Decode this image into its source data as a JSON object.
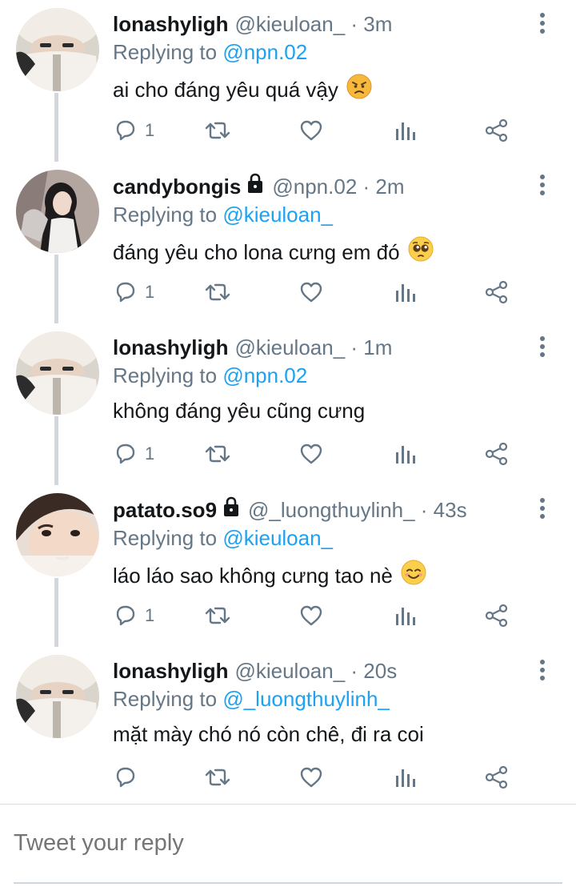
{
  "tweets": [
    {
      "name": "lonashyligh",
      "locked": false,
      "handle_time": "@kieuloan_ · 3m",
      "replying_prefix": "Replying to",
      "replying_to": "@npn.02",
      "text": "ai cho đáng yêu quá vậy",
      "emoji": "angry-face",
      "reply_count": "1",
      "avatar": "white-fluffy-hat-photo"
    },
    {
      "name": "candybongis",
      "locked": true,
      "handle_time": "@npn.02 · 2m",
      "replying_prefix": "Replying to",
      "replying_to": "@kieuloan_",
      "text": "đáng yêu cho lona cưng em đó",
      "emoji": "pleading-face",
      "reply_count": "1",
      "avatar": "girl-dark-hair-photo"
    },
    {
      "name": "lonashyligh",
      "locked": false,
      "handle_time": "@kieuloan_ · 1m",
      "replying_prefix": "Replying to",
      "replying_to": "@npn.02",
      "text": "không đáng yêu cũng cưng",
      "emoji": "",
      "reply_count": "1",
      "avatar": "white-fluffy-hat-photo"
    },
    {
      "name": "patato.so9",
      "locked": true,
      "handle_time": "@_luongthuylinh_ · 43s",
      "replying_prefix": "Replying to",
      "replying_to": "@kieuloan_",
      "text": "láo láo sao không cưng tao nè",
      "emoji": "smiling-face",
      "reply_count": "1",
      "avatar": "face-closeup-photo"
    },
    {
      "name": "lonashyligh",
      "locked": false,
      "handle_time": "@kieuloan_ · 20s",
      "replying_prefix": "Replying to",
      "replying_to": "@_luongthuylinh_",
      "text": "mặt mày chó nó còn chê, đi ra coi",
      "emoji": "",
      "reply_count": "",
      "avatar": "white-fluffy-hat-photo"
    }
  ],
  "composer": {
    "placeholder": "Tweet your reply"
  },
  "colors": {
    "text": "#14171a",
    "secondary": "#657786",
    "link": "#1da1f2",
    "thread_line": "#d3d6da"
  }
}
